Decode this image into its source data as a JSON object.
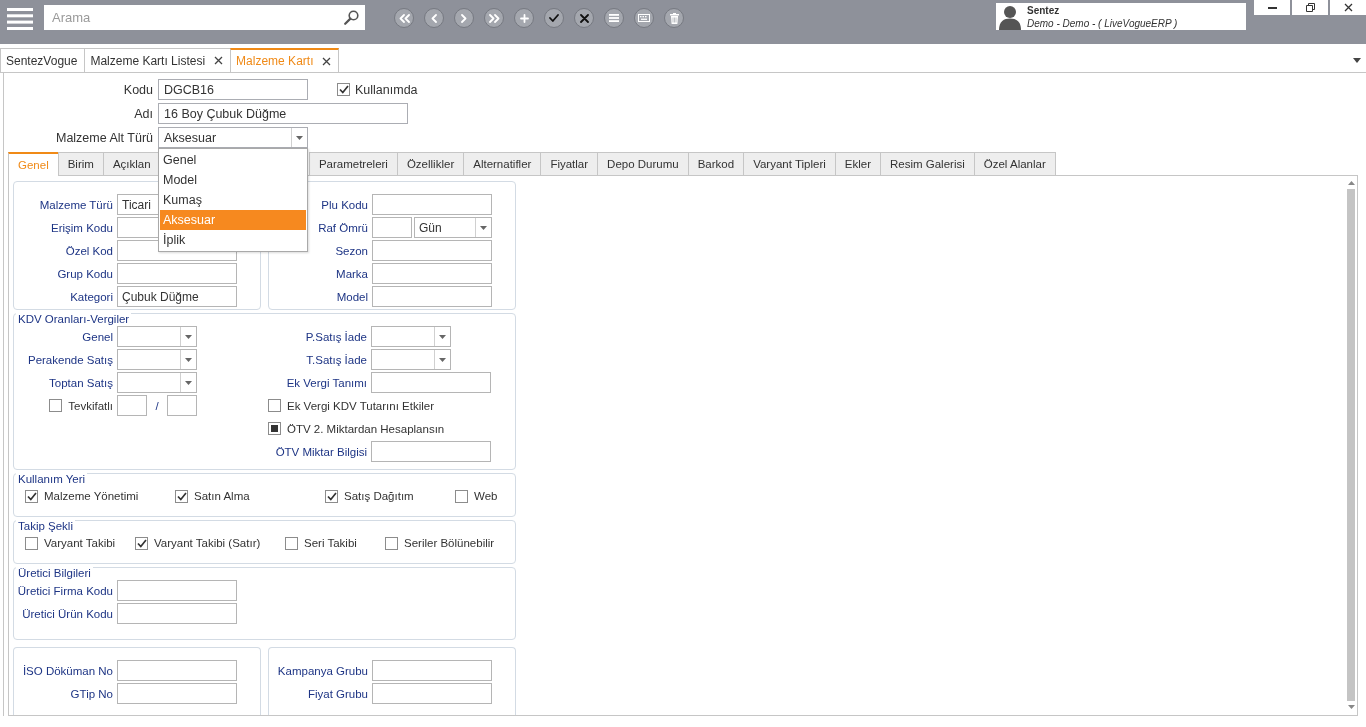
{
  "topbar": {
    "search": {
      "placeholder": "Arama"
    },
    "user": {
      "name": "Sentez",
      "detail": "Demo - Demo - ( LiveVogueERP )"
    }
  },
  "doc_tabs": [
    {
      "label": "SentezVogue",
      "closable": false,
      "selected": false
    },
    {
      "label": "Malzeme Kartı Listesi",
      "closable": true,
      "selected": false
    },
    {
      "label": "Malzeme Kartı",
      "closable": true,
      "selected": true
    }
  ],
  "header": {
    "code": {
      "label": "Kodu",
      "value": "DGCB16"
    },
    "in_use": {
      "label": "Kullanımda",
      "checked": true
    },
    "name": {
      "label": "Adı",
      "value": "16 Boy Çubuk Düğme"
    },
    "subtype": {
      "label": "Malzeme Alt Türü",
      "value": "Aksesuar",
      "expanded": true,
      "options": [
        {
          "label": "Genel",
          "selected": false
        },
        {
          "label": "Model",
          "selected": false
        },
        {
          "label": "Kumaş",
          "selected": false
        },
        {
          "label": "Aksesuar",
          "selected": true
        },
        {
          "label": "İplik",
          "selected": false
        }
      ]
    }
  },
  "form_tabs": [
    {
      "label": "Genel",
      "selected": true
    },
    {
      "label": "Birim",
      "selected": false
    },
    {
      "label": "Açıklan",
      "selected": false
    },
    {
      "label": "Parametreleri",
      "selected": false
    },
    {
      "label": "Özellikler",
      "selected": false
    },
    {
      "label": "Alternatifler",
      "selected": false
    },
    {
      "label": "Fiyatlar",
      "selected": false
    },
    {
      "label": "Depo Durumu",
      "selected": false
    },
    {
      "label": "Barkod",
      "selected": false
    },
    {
      "label": "Varyant Tipleri",
      "selected": false
    },
    {
      "label": "Ekler",
      "selected": false
    },
    {
      "label": "Resim Galerisi",
      "selected": false
    },
    {
      "label": "Özel Alanlar",
      "selected": false
    }
  ],
  "general": {
    "identity_left": [
      {
        "label": "Malzeme Türü",
        "value": "Ticari"
      },
      {
        "label": "Erişim Kodu"
      },
      {
        "label": "Özel Kod"
      },
      {
        "label": "Grup Kodu"
      },
      {
        "label": "Kategori",
        "value": "Çubuk Düğme"
      }
    ],
    "identity_right": [
      {
        "kind": "input",
        "label": "Plu Kodu"
      },
      {
        "kind": "input_combo",
        "label": "Raf Ömrü",
        "unit": "Gün"
      },
      {
        "kind": "input",
        "label": "Sezon"
      },
      {
        "kind": "input",
        "label": "Marka"
      },
      {
        "kind": "input",
        "label": "Model"
      }
    ],
    "taxes": {
      "title": "KDV Oranları-Vergiler",
      "left": [
        {
          "kind": "combo",
          "label": "Genel"
        },
        {
          "kind": "combo",
          "label": "Perakende Satış"
        },
        {
          "kind": "combo",
          "label": "Toptan Satış"
        },
        {
          "kind": "ratio",
          "label": "Tevkifatlı",
          "checked": false,
          "separator": "/"
        }
      ],
      "right": [
        {
          "kind": "combo",
          "label": "P.Satış İade"
        },
        {
          "kind": "combo",
          "label": "T.Satış İade"
        },
        {
          "kind": "input",
          "label": "Ek Vergi Tanımı"
        },
        {
          "kind": "checkbox",
          "label": "Ek Vergi KDV Tutarını Etkiler",
          "checked": false,
          "indeterminate": false
        },
        {
          "kind": "checkbox",
          "label": "ÖTV 2. Miktardan Hesaplansın",
          "checked": false,
          "indeterminate": true
        },
        {
          "kind": "input",
          "label": "ÖTV Miktar Bilgisi"
        }
      ]
    },
    "usage": {
      "title": "Kullanım Yeri",
      "items": [
        {
          "label": "Malzeme Yönetimi",
          "checked": true
        },
        {
          "label": "Satın Alma",
          "checked": true
        },
        {
          "label": "Satış Dağıtım",
          "checked": true
        },
        {
          "label": "Web",
          "checked": false
        }
      ]
    },
    "tracking": {
      "title": "Takip Şekli",
      "items": [
        {
          "label": "Varyant Takibi",
          "checked": false
        },
        {
          "label": "Varyant Takibi (Satır)",
          "checked": true
        },
        {
          "label": "Seri Takibi",
          "checked": false
        },
        {
          "label": "Seriler Bölünebilir",
          "checked": false
        }
      ]
    },
    "manufacturer": {
      "title": "Üretici Bilgileri",
      "fields": [
        {
          "label": "Üretici Firma Kodu"
        },
        {
          "label": "Üretici Ürün Kodu"
        }
      ]
    },
    "documents": [
      {
        "label": "İSO Döküman No"
      },
      {
        "label": "GTip No"
      }
    ],
    "pricing": [
      {
        "label": "Kampanya Grubu"
      },
      {
        "label": "Fiyat Grubu"
      }
    ]
  }
}
